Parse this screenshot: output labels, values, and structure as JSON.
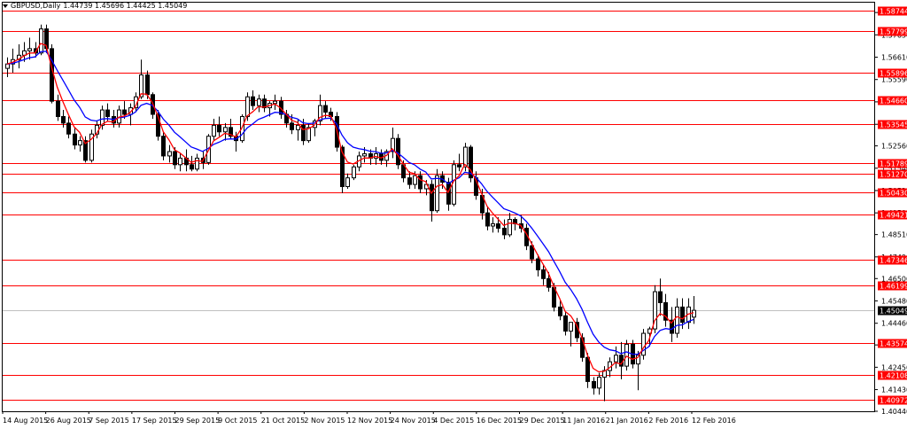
{
  "header": {
    "symbol_label": "GBPUSD,Daily",
    "ohlc_values": "1.44739 1.45696 1.44425 1.45049"
  },
  "colors": {
    "level_line": "#ff0000",
    "ma_fast": "#ff0000",
    "ma_slow": "#0000ff",
    "candle": "#000000",
    "price_label_bg": "#ff0000",
    "current_label_bg": "#000000"
  },
  "chart_data": {
    "type": "candlestick",
    "symbol": "GBPUSD",
    "timeframe": "Daily",
    "ylim": [
      1.4044,
      1.591
    ],
    "y_ticks": [
      "1.58650",
      "1.57630",
      "1.56610",
      "1.55590",
      "1.54570",
      "1.53545",
      "1.52560",
      "1.51540",
      "1.50520",
      "1.49500",
      "1.48510",
      "1.47490",
      "1.46500",
      "1.45480",
      "1.44460",
      "1.43470",
      "1.42450",
      "1.41430",
      "1.40440"
    ],
    "x_tick_labels": [
      "14 Aug 2015",
      "26 Aug 2015",
      "7 Sep 2015",
      "17 Sep 2015",
      "29 Sep 2015",
      "9 Oct 2015",
      "21 Oct 2015",
      "2 Nov 2015",
      "12 Nov 2015",
      "24 Nov 2015",
      "4 Dec 2015",
      "16 Dec 2015",
      "29 Dec 2015",
      "11 Jan 2016",
      "21 Jan 2016",
      "2 Feb 2016",
      "12 Feb 2016"
    ],
    "levels": [
      1.58744,
      1.57799,
      1.55896,
      1.5466,
      1.53545,
      1.51789,
      1.5127,
      1.5043,
      1.49421,
      1.47346,
      1.46199,
      1.43574,
      1.42108,
      1.40972
    ],
    "level_labels": [
      "1.58744",
      "1.57799",
      "1.55896",
      "1.54660",
      "1.53545",
      "1.51789",
      "1.51270",
      "1.50430",
      "1.49421",
      "1.47346",
      "1.46199",
      "1.43574",
      "1.42108",
      "1.40972"
    ],
    "current_price": "1.45049",
    "current_value": 1.45049,
    "candles": [
      [
        1.561,
        1.566,
        1.557,
        1.563
      ],
      [
        1.563,
        1.57,
        1.559,
        1.565
      ],
      [
        1.565,
        1.572,
        1.561,
        1.567
      ],
      [
        1.567,
        1.573,
        1.564,
        1.569
      ],
      [
        1.569,
        1.575,
        1.565,
        1.57
      ],
      [
        1.57,
        1.573,
        1.566,
        1.568
      ],
      [
        1.568,
        1.581,
        1.567,
        1.579
      ],
      [
        1.579,
        1.581,
        1.568,
        1.57
      ],
      [
        1.57,
        1.572,
        1.545,
        1.546
      ],
      [
        1.546,
        1.549,
        1.537,
        1.539
      ],
      [
        1.539,
        1.542,
        1.534,
        1.536
      ],
      [
        1.536,
        1.539,
        1.529,
        1.531
      ],
      [
        1.531,
        1.534,
        1.524,
        1.526
      ],
      [
        1.526,
        1.53,
        1.523,
        1.528
      ],
      [
        1.528,
        1.53,
        1.518,
        1.519
      ],
      [
        1.519,
        1.533,
        1.518,
        1.531
      ],
      [
        1.531,
        1.537,
        1.529,
        1.535
      ],
      [
        1.535,
        1.544,
        1.533,
        1.542
      ],
      [
        1.542,
        1.545,
        1.537,
        1.539
      ],
      [
        1.539,
        1.542,
        1.534,
        1.536
      ],
      [
        1.536,
        1.544,
        1.534,
        1.542
      ],
      [
        1.542,
        1.546,
        1.538,
        1.54
      ],
      [
        1.54,
        1.545,
        1.535,
        1.543
      ],
      [
        1.543,
        1.55,
        1.541,
        1.548
      ],
      [
        1.548,
        1.565,
        1.547,
        1.558
      ],
      [
        1.558,
        1.56,
        1.547,
        1.549
      ],
      [
        1.549,
        1.55,
        1.538,
        1.54
      ],
      [
        1.54,
        1.542,
        1.528,
        1.53
      ],
      [
        1.53,
        1.532,
        1.519,
        1.521
      ],
      [
        1.521,
        1.526,
        1.518,
        1.523
      ],
      [
        1.523,
        1.525,
        1.515,
        1.517
      ],
      [
        1.517,
        1.522,
        1.514,
        1.52
      ],
      [
        1.52,
        1.524,
        1.514,
        1.517
      ],
      [
        1.517,
        1.521,
        1.514,
        1.515
      ],
      [
        1.515,
        1.522,
        1.514,
        1.52
      ],
      [
        1.52,
        1.523,
        1.515,
        1.518
      ],
      [
        1.518,
        1.531,
        1.517,
        1.53
      ],
      [
        1.53,
        1.538,
        1.528,
        1.535
      ],
      [
        1.535,
        1.539,
        1.53,
        1.532
      ],
      [
        1.532,
        1.536,
        1.528,
        1.534
      ],
      [
        1.534,
        1.538,
        1.529,
        1.53
      ],
      [
        1.53,
        1.532,
        1.523,
        1.528
      ],
      [
        1.528,
        1.54,
        1.527,
        1.539
      ],
      [
        1.539,
        1.55,
        1.537,
        1.548
      ],
      [
        1.548,
        1.551,
        1.542,
        1.544
      ],
      [
        1.544,
        1.549,
        1.541,
        1.547
      ],
      [
        1.547,
        1.549,
        1.541,
        1.543
      ],
      [
        1.543,
        1.546,
        1.539,
        1.545
      ],
      [
        1.545,
        1.549,
        1.542,
        1.546
      ],
      [
        1.546,
        1.548,
        1.538,
        1.54
      ],
      [
        1.54,
        1.542,
        1.534,
        1.536
      ],
      [
        1.536,
        1.54,
        1.531,
        1.533
      ],
      [
        1.533,
        1.538,
        1.528,
        1.535
      ],
      [
        1.535,
        1.538,
        1.526,
        1.528
      ],
      [
        1.528,
        1.536,
        1.527,
        1.534
      ],
      [
        1.534,
        1.538,
        1.53,
        1.537
      ],
      [
        1.537,
        1.549,
        1.535,
        1.544
      ],
      [
        1.544,
        1.546,
        1.538,
        1.541
      ],
      [
        1.541,
        1.543,
        1.537,
        1.539
      ],
      [
        1.539,
        1.541,
        1.523,
        1.525
      ],
      [
        1.525,
        1.526,
        1.504,
        1.507
      ],
      [
        1.507,
        1.513,
        1.506,
        1.511
      ],
      [
        1.511,
        1.517,
        1.51,
        1.516
      ],
      [
        1.516,
        1.523,
        1.514,
        1.521
      ],
      [
        1.521,
        1.525,
        1.518,
        1.522
      ],
      [
        1.522,
        1.524,
        1.517,
        1.52
      ],
      [
        1.52,
        1.525,
        1.517,
        1.522
      ],
      [
        1.522,
        1.524,
        1.517,
        1.519
      ],
      [
        1.519,
        1.524,
        1.516,
        1.523
      ],
      [
        1.523,
        1.534,
        1.52,
        1.529
      ],
      [
        1.529,
        1.531,
        1.515,
        1.517
      ],
      [
        1.517,
        1.519,
        1.509,
        1.511
      ],
      [
        1.511,
        1.514,
        1.506,
        1.508
      ],
      [
        1.508,
        1.514,
        1.506,
        1.512
      ],
      [
        1.512,
        1.514,
        1.504,
        1.506
      ],
      [
        1.506,
        1.51,
        1.503,
        1.508
      ],
      [
        1.508,
        1.51,
        1.491,
        1.496
      ],
      [
        1.496,
        1.515,
        1.495,
        1.512
      ],
      [
        1.512,
        1.514,
        1.506,
        1.509
      ],
      [
        1.509,
        1.511,
        1.496,
        1.499
      ],
      [
        1.499,
        1.519,
        1.498,
        1.517
      ],
      [
        1.517,
        1.522,
        1.514,
        1.516
      ],
      [
        1.516,
        1.527,
        1.514,
        1.525
      ],
      [
        1.525,
        1.526,
        1.509,
        1.511
      ],
      [
        1.511,
        1.514,
        1.501,
        1.503
      ],
      [
        1.503,
        1.506,
        1.492,
        1.495
      ],
      [
        1.495,
        1.498,
        1.487,
        1.489
      ],
      [
        1.489,
        1.493,
        1.486,
        1.49
      ],
      [
        1.49,
        1.493,
        1.486,
        1.488
      ],
      [
        1.488,
        1.492,
        1.483,
        1.485
      ],
      [
        1.485,
        1.495,
        1.484,
        1.492
      ],
      [
        1.492,
        1.493,
        1.487,
        1.49
      ],
      [
        1.49,
        1.494,
        1.486,
        1.488
      ],
      [
        1.488,
        1.49,
        1.478,
        1.48
      ],
      [
        1.48,
        1.482,
        1.472,
        1.474
      ],
      [
        1.474,
        1.476,
        1.466,
        1.469
      ],
      [
        1.469,
        1.471,
        1.462,
        1.465
      ],
      [
        1.465,
        1.468,
        1.459,
        1.461
      ],
      [
        1.461,
        1.463,
        1.45,
        1.452
      ],
      [
        1.452,
        1.455,
        1.446,
        1.448
      ],
      [
        1.448,
        1.45,
        1.439,
        1.441
      ],
      [
        1.441,
        1.444,
        1.434,
        1.445
      ],
      [
        1.445,
        1.447,
        1.436,
        1.438
      ],
      [
        1.438,
        1.44,
        1.427,
        1.429
      ],
      [
        1.429,
        1.431,
        1.415,
        1.418
      ],
      [
        1.418,
        1.42,
        1.412,
        1.415
      ],
      [
        1.415,
        1.422,
        1.412,
        1.42
      ],
      [
        1.42,
        1.425,
        1.409,
        1.423
      ],
      [
        1.423,
        1.429,
        1.42,
        1.427
      ],
      [
        1.427,
        1.434,
        1.424,
        1.43
      ],
      [
        1.43,
        1.436,
        1.419,
        1.425
      ],
      [
        1.425,
        1.437,
        1.423,
        1.435
      ],
      [
        1.435,
        1.437,
        1.424,
        1.426
      ],
      [
        1.426,
        1.432,
        1.414,
        1.43
      ],
      [
        1.43,
        1.442,
        1.428,
        1.44
      ],
      [
        1.44,
        1.443,
        1.434,
        1.442
      ],
      [
        1.442,
        1.462,
        1.44,
        1.459
      ],
      [
        1.459,
        1.465,
        1.448,
        1.454
      ],
      [
        1.454,
        1.458,
        1.443,
        1.446
      ],
      [
        1.446,
        1.452,
        1.436,
        1.44
      ],
      [
        1.44,
        1.456,
        1.438,
        1.452
      ],
      [
        1.452,
        1.456,
        1.442,
        1.445
      ],
      [
        1.445,
        1.456,
        1.442,
        1.452
      ],
      [
        1.4474,
        1.457,
        1.4443,
        1.4505
      ]
    ]
  }
}
